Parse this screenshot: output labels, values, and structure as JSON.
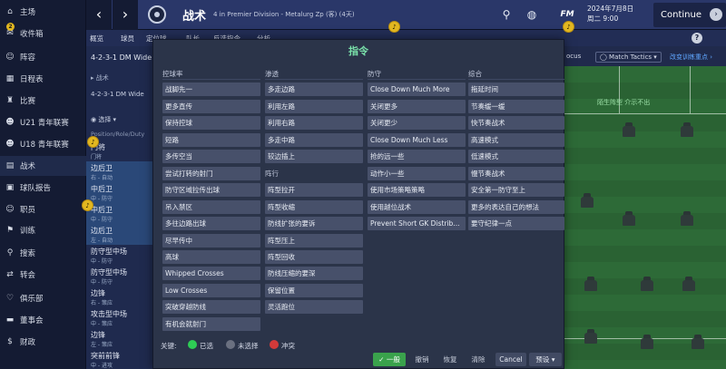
{
  "sidebar": {
    "items": [
      {
        "label": "主场",
        "icon": "⌂",
        "name": "home"
      },
      {
        "label": "收件箱",
        "icon": "✉",
        "name": "inbox"
      },
      {
        "label": "阵容",
        "icon": "☺",
        "name": "squad"
      },
      {
        "label": "日程表",
        "icon": "▦",
        "name": "schedule"
      },
      {
        "label": "比赛",
        "icon": "♜",
        "name": "competitions"
      },
      {
        "label": "U21 青年联赛",
        "icon": "☻",
        "name": "u21"
      },
      {
        "label": "U18 青年联赛",
        "icon": "☻",
        "name": "u18"
      },
      {
        "label": "战术",
        "icon": "▤",
        "name": "tactics"
      },
      {
        "label": "球队报告",
        "icon": "▣",
        "name": "team-report"
      },
      {
        "label": "职员",
        "icon": "☺",
        "name": "staff"
      },
      {
        "label": "训练",
        "icon": "⚑",
        "name": "training"
      },
      {
        "label": "搜索",
        "icon": "⚲",
        "name": "scouting"
      },
      {
        "label": "转会",
        "icon": "⇄",
        "name": "transfers"
      },
      {
        "label": "俱乐部",
        "icon": "♡",
        "name": "club"
      },
      {
        "label": "董事会",
        "icon": "▬",
        "name": "board"
      },
      {
        "label": "财政",
        "icon": "$",
        "name": "finances"
      }
    ],
    "inbox_badge": "2"
  },
  "topbar": {
    "back": "‹",
    "forward": "›",
    "title": "战术",
    "subtitle": "4 in Premier Division - Metalurg Zp (客) (4天)",
    "fm_label": "FM",
    "date_line1": "2024年7月8日",
    "date_line2": "周二 9:00",
    "continue_label": "Continue",
    "continue_arrow": "›",
    "search_icon": "⚲",
    "globe_icon": "◍"
  },
  "subnav": {
    "items": [
      "概览",
      "球员",
      "定位球",
      "队长",
      "反选指令",
      "分析"
    ],
    "help": "?"
  },
  "tactics_panel": {
    "formation_top": "4-2-3-1 DM Wide",
    "tactic_label": "▸ 战术",
    "formation_sub": "4-2-3-1 DM Wide",
    "select_label": "◉ 选择 ▾",
    "pos_header": "Position/Role/Duty",
    "positions": [
      {
        "name": "门将",
        "role": "门将"
      },
      {
        "name": "边后卫",
        "role": "右 - 自动"
      },
      {
        "name": "中后卫",
        "role": "中 - 防守"
      },
      {
        "name": "中后卫",
        "role": "中 - 防守"
      },
      {
        "name": "边后卫",
        "role": "左 - 自动"
      },
      {
        "name": "防守型中场",
        "role": "中 - 防守"
      },
      {
        "name": "防守型中场",
        "role": "中 - 防守"
      },
      {
        "name": "边锋",
        "role": "右 - 策应"
      },
      {
        "name": "攻击型中场",
        "role": "中 - 策应"
      },
      {
        "name": "边锋",
        "role": "左 - 策应"
      },
      {
        "name": "突前前锋",
        "role": "中 - 进攻"
      }
    ]
  },
  "right_panel": {
    "focus": "ocus",
    "match_tactics": "◯ Match Tactics ▾",
    "link": "改变训练重点 ›",
    "unknown": "陌生阵型\n介示不出"
  },
  "modal": {
    "title": "指令",
    "columns": {
      "col1": "控球率",
      "col2": "渗透",
      "col2b": "阵行",
      "col3": "防守",
      "col4": "综合"
    },
    "col1_items": [
      "战脚先一",
      "更多直传",
      "保持控球",
      "短路",
      "多传空当",
      "尝试打转的射门",
      "防守区域拉传出球",
      "吊入禁区",
      "多往边路出球",
      "尽早传中",
      "高球",
      "Whipped Crosses",
      "Low Crosses",
      "突破穿越防线",
      "有机会就射门"
    ],
    "col2_items": [
      "多走边路",
      "利用左路",
      "利用右路",
      "多走中路",
      "较边插上"
    ],
    "col2b_items": [
      "阵型拉开",
      "阵型收缩",
      "防线扩张的要诉",
      "阵型压上",
      "阵型回收",
      "防线压缩的要深",
      "保留位置",
      "灵活跑位"
    ],
    "col3_items": [
      "Close Down Much More",
      "关闭更多",
      "关闭更少",
      "Close Down Much Less",
      "抢的远一些",
      "动作小一些",
      "使用市场策略策略",
      "使用越位战术",
      "Prevent Short GK Distrib..."
    ],
    "col4_items": [
      "拖延时间",
      "节奏缓一缓",
      "快节奏战术",
      "高速模式",
      "低速模式",
      "慢节奏战术",
      "安全第一防守至上",
      "更多的表达自己的想法",
      "要守纪律一点"
    ],
    "footer": {
      "legend_label": "关键:",
      "legend_selected": "已选",
      "legend_unselected": "未选择",
      "legend_conflict": "冲突",
      "color_selected": "#2ecc55",
      "color_unselected": "#6a7080",
      "color_conflict": "#d23a3a",
      "btn_general": "✓ 一般",
      "btn_undo": "撤销",
      "btn_restore": "恢复",
      "btn_clear": "清除",
      "btn_cancel": "Cancel",
      "btn_preset": "预设 ▾"
    }
  },
  "hints": [
    "♪",
    "♪",
    "♪",
    "♪"
  ]
}
